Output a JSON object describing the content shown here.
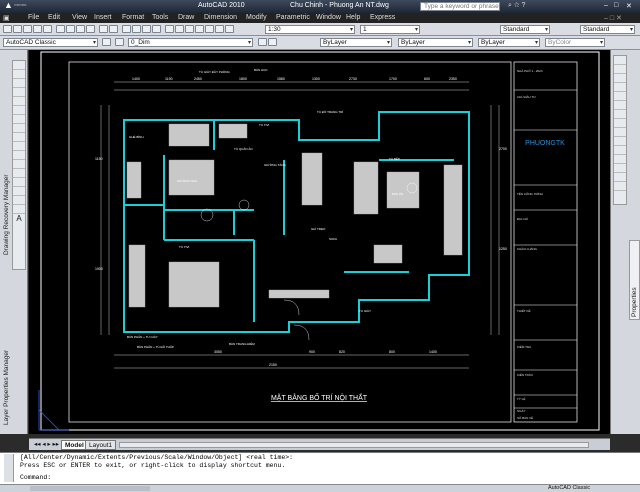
{
  "window": {
    "title": "AutoCAD 2010",
    "document": "Chu Chinh - Phuong An NT.dwg",
    "search_placeholder": "Type a keyword or phrase"
  },
  "menu": [
    "File",
    "Edit",
    "View",
    "Insert",
    "Format",
    "Tools",
    "Draw",
    "Dimension",
    "Modify",
    "Parametric",
    "Window",
    "Help",
    "Express"
  ],
  "toolbar": {
    "workspace": "AutoCAD Classic",
    "layer": "0_Dim",
    "color": "ByLayer",
    "linetype": "ByLayer",
    "lineweight": "ByLayer",
    "plotstyle": "ByColor",
    "scale": "1:30",
    "annoscale": "1",
    "textstyle": "Standard",
    "dimstyle": "Standard"
  },
  "palettes": {
    "left1": "Drawing Recovery Manager",
    "left2": "Layer Properties Manager",
    "right": "Properties"
  },
  "drawing": {
    "title": "MẶT BẰNG BỐ TRÍ NỘI THẤT",
    "brand": "PHUONGTK",
    "room_labels": [
      "TỦ GIÀY ĐẦY PHÒNG",
      "BÀN HỌC",
      "TỦ ĐỒ TRANG TRÍ",
      "TỦ TIVI",
      "GHÉ BÌNH",
      "TỦ QUẦN ÁO",
      "GIƯỜNG NGỦ",
      "GIƯỜNG TẦNG",
      "BÀN PHẤN + TỦ GIÀY",
      "TỦ TIVI",
      "BÀN PHẤN + TỦ ĐỒ THẤP",
      "BÀN TRANG ĐIỂM",
      "TỦ BẾP",
      "BÀN ĂN",
      "SOFA",
      "GIÁ TREO",
      "TỦ GIÀY"
    ],
    "dims": [
      "1400",
      "1190",
      "2450",
      "1800",
      "1580",
      "1300",
      "2730",
      "1700",
      "600",
      "2350",
      "3050",
      "900",
      "820",
      "800",
      "1400",
      "2150",
      "2700",
      "1250",
      "1150",
      "1900"
    ],
    "block_lines": [
      "NHÀ PHỐ 1 - 2024",
      "CHỦ ĐẦU TƯ",
      "TÊN CÔNG TRÌNH",
      "ĐỊA CHỈ",
      "KHÁCH HÀNG",
      "THIẾT KẾ",
      "KIỂM TRA",
      "KIẾN TRÚC",
      "TỶ LỆ",
      "NGÀY",
      "SỐ BẢN VẼ"
    ]
  },
  "layout_tabs": [
    "Model",
    "Layout1"
  ],
  "command": {
    "line1": "[All/Center/Dynamic/Extents/Previous/Scale/Window/Object] <real time>:",
    "line2": "Press ESC or ENTER to exit, or right-click to display shortcut menu.",
    "prompt": "Command:"
  },
  "status": {
    "workspace": "AutoCAD Classic"
  }
}
